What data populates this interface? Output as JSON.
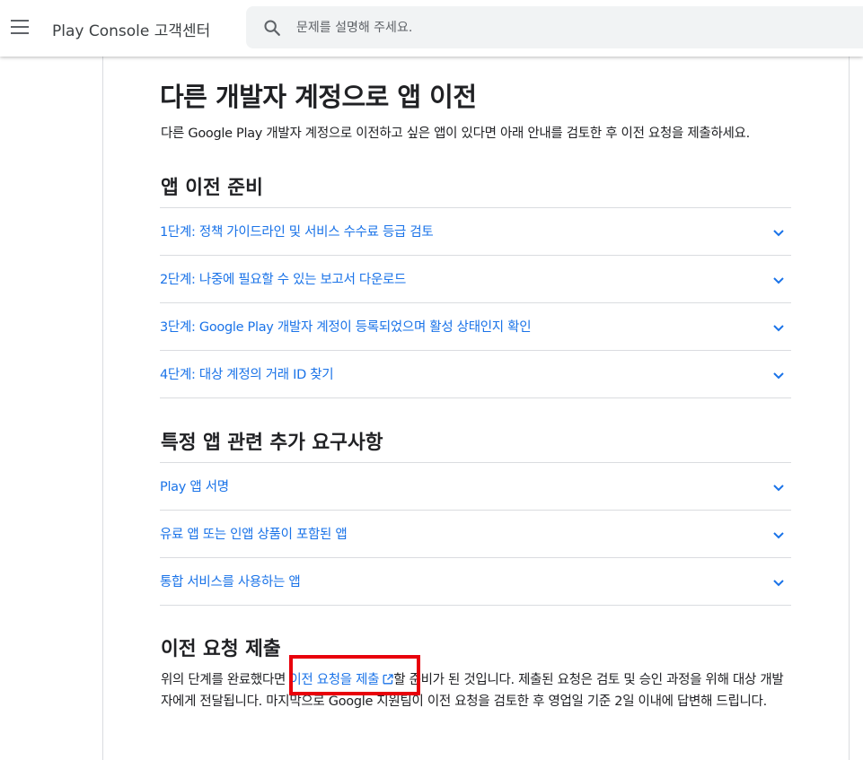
{
  "header": {
    "product_title": "Play Console 고객센터",
    "search_placeholder": "문제를 설명해 주세요."
  },
  "article": {
    "title": "다른 개발자 계정으로 앱 이전",
    "intro": "다른 Google Play 개발자 계정으로 이전하고 싶은 앱이 있다면 아래 안내를 검토한 후 이전 요청을 제출하세요.",
    "sections": [
      {
        "heading": "앱 이전 준비",
        "items": [
          "1단계: 정책 가이드라인 및 서비스 수수료 등급 검토",
          "2단계: 나중에 필요할 수 있는 보고서 다운로드",
          "3단계: Google Play 개발자 계정이 등록되었으며 활성 상태인지 확인",
          "4단계: 대상 계정의 거래 ID 찾기"
        ]
      },
      {
        "heading": "특정 앱 관련 추가 요구사항",
        "items": [
          "Play 앱 서명",
          "유료 앱 또는 인앱 상품이 포함된 앱",
          "통합 서비스를 사용하는 앱"
        ]
      }
    ],
    "submit_section": {
      "heading": "이전 요청 제출",
      "text_before": "위의 단계를 완료했다면 ",
      "link_text": "이전 요청을 제출",
      "text_after": "할 준비가 된 것입니다. 제출된 요청은 검토 및 승인 과정을 위해 대상 개발자에게 전달됩니다. 마지막으로 Google 지원팀이 이전 요청을 검토한 후 영업일 기준 2일 이내에 답변해 드립니다."
    }
  },
  "colors": {
    "link": "#1a73e8",
    "highlight": "#e8000b",
    "divider": "#dadce0"
  }
}
